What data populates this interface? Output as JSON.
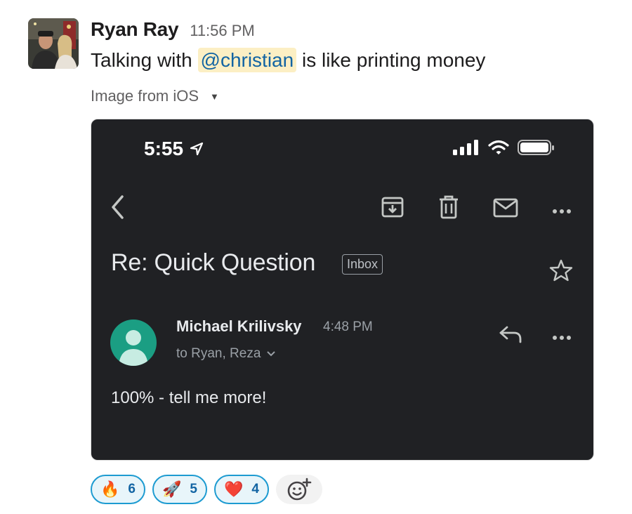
{
  "message": {
    "author": "Ryan Ray",
    "time": "11:56 PM",
    "text_before": "Talking with ",
    "mention": "@christian",
    "text_after": " is like printing money",
    "file_label": "Image from iOS"
  },
  "screenshot": {
    "status_time": "5:55",
    "subject": "Re: Quick Question",
    "label_chip": "Inbox",
    "sender_name": "Michael Krilivsky",
    "sender_time": "4:48 PM",
    "recipients": "to Ryan, Reza",
    "body": "100% - tell me more!",
    "toolbar_icons": [
      "back-arrow-icon",
      "archive-icon",
      "trash-icon",
      "mail-icon",
      "more-icon"
    ]
  },
  "reactions": [
    {
      "emoji": "🔥",
      "name": "fire",
      "count": "6"
    },
    {
      "emoji": "🚀",
      "name": "rocket",
      "count": "5"
    },
    {
      "emoji": "❤️",
      "name": "heart",
      "count": "4"
    }
  ],
  "colors": {
    "mention_bg": "#fcefc4",
    "mention_text": "#1264a3",
    "reaction_border": "#1d9bd1",
    "reaction_bg": "#e8f5fa",
    "dark_bg": "#202124",
    "sender_avatar": "#1b9e83"
  }
}
